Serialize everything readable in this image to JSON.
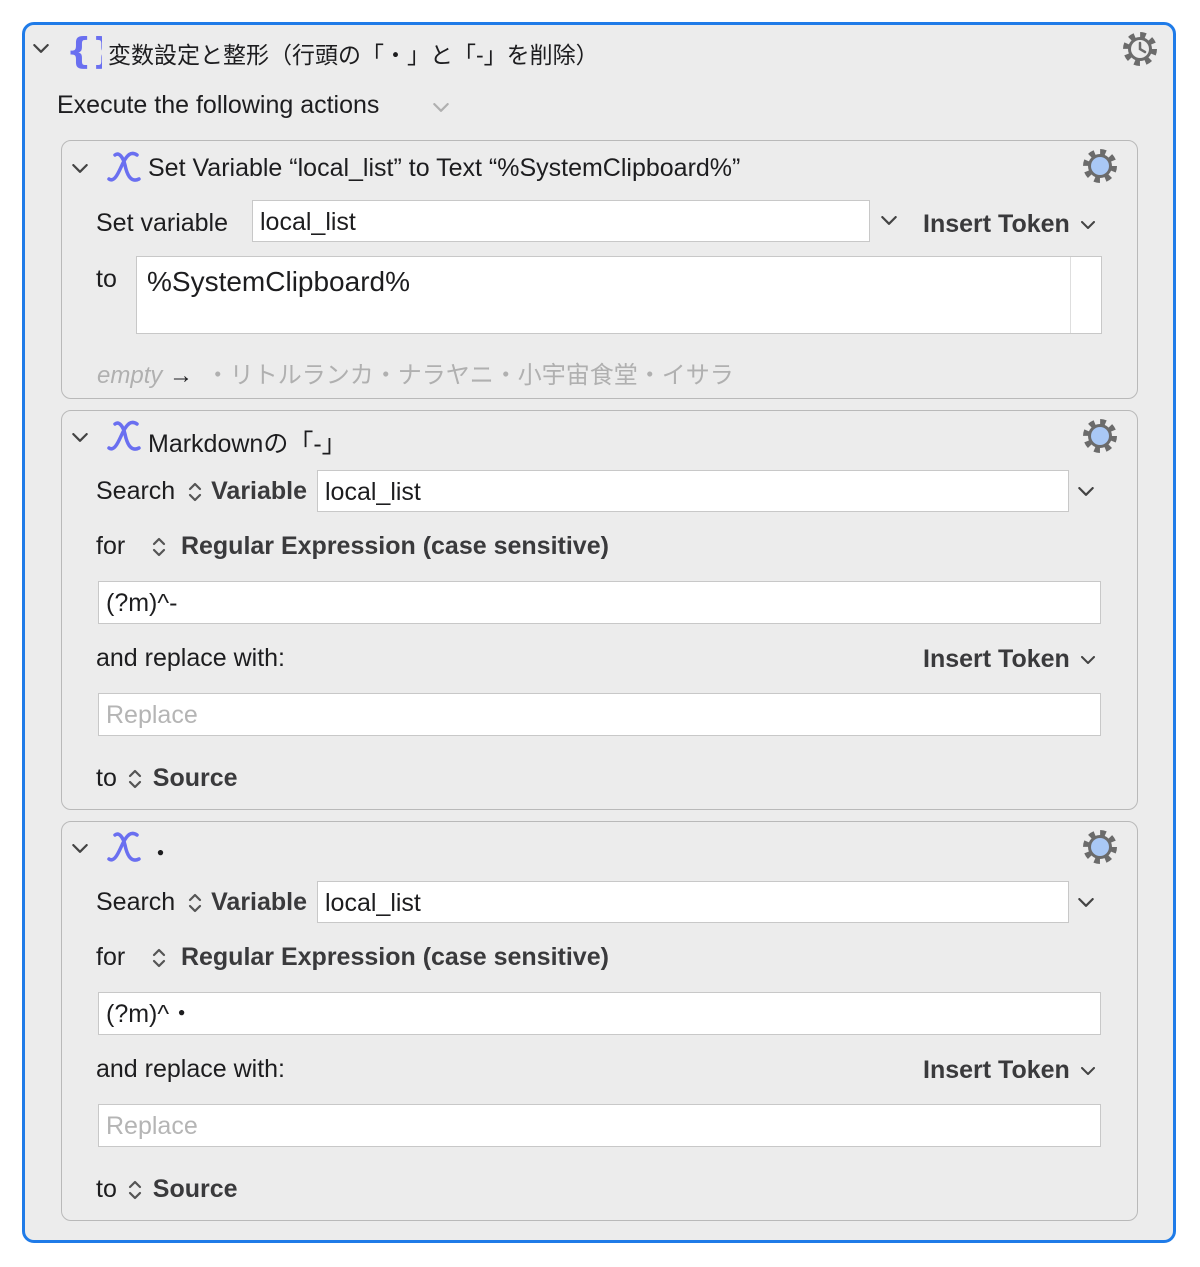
{
  "group": {
    "title": "変数設定と整形（行頭の「・」と「-」を削除）",
    "execute_label": "Execute the following actions"
  },
  "actions": [
    {
      "title": "Set Variable “local_list” to Text “%SystemClipboard%”",
      "set_variable_label": "Set variable",
      "variable_value": "local_list",
      "insert_token_label": "Insert Token",
      "to_label": "to",
      "text_value": "%SystemClipboard%",
      "preview_empty": "empty",
      "preview_arrow": "→",
      "preview_result": "・リトルランカ・ナラヤニ・小宇宙食堂・イサラ"
    },
    {
      "title": "Markdownの「-」",
      "search_label": "Search",
      "search_type": "Variable",
      "variable_value": "local_list",
      "for_label": "for",
      "match_type": "Regular Expression (case sensitive)",
      "pattern": "(?m)^-",
      "replace_label": "and replace with:",
      "insert_token_label": "Insert Token",
      "replace_placeholder": "Replace",
      "to_label": "to",
      "destination": "Source"
    },
    {
      "title": "・",
      "search_label": "Search",
      "search_type": "Variable",
      "variable_value": "local_list",
      "for_label": "for",
      "match_type": "Regular Expression (case sensitive)",
      "pattern": "(?m)^・",
      "replace_label": "and replace with:",
      "insert_token_label": "Insert Token",
      "replace_placeholder": "Replace",
      "to_label": "to",
      "destination": "Source"
    }
  ],
  "colors": {
    "accent_border": "#1f7be8",
    "icon_purple": "#6a6ff0",
    "gear_blue": "#a9c8f5"
  }
}
